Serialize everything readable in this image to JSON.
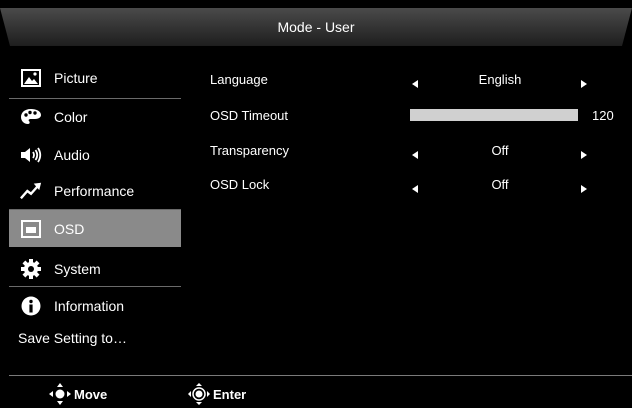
{
  "header": {
    "title": "Mode - User"
  },
  "menu": {
    "items": [
      {
        "label": "Picture",
        "icon": "picture-icon"
      },
      {
        "label": "Color",
        "icon": "palette-icon"
      },
      {
        "label": "Audio",
        "icon": "speaker-icon"
      },
      {
        "label": "Performance",
        "icon": "trend-arrow-icon"
      },
      {
        "label": "OSD",
        "icon": "osd-icon"
      },
      {
        "label": "System",
        "icon": "gear-icon"
      },
      {
        "label": "Information",
        "icon": "info-icon"
      }
    ],
    "active": "OSD",
    "save_setting": "Save Setting to…"
  },
  "settings": {
    "language": {
      "label": "Language",
      "value": "English"
    },
    "osd_timeout": {
      "label": "OSD Timeout",
      "value": "120",
      "level_fraction": 1.0
    },
    "transparency": {
      "label": "Transparency",
      "value": "Off"
    },
    "osd_lock": {
      "label": "OSD Lock",
      "value": "Off"
    }
  },
  "footer": {
    "move_label": "Move",
    "enter_label": "Enter"
  },
  "colors": {
    "active_bg": "#8a8a8a",
    "slider": "#d0d0d0",
    "background": "#000000"
  }
}
